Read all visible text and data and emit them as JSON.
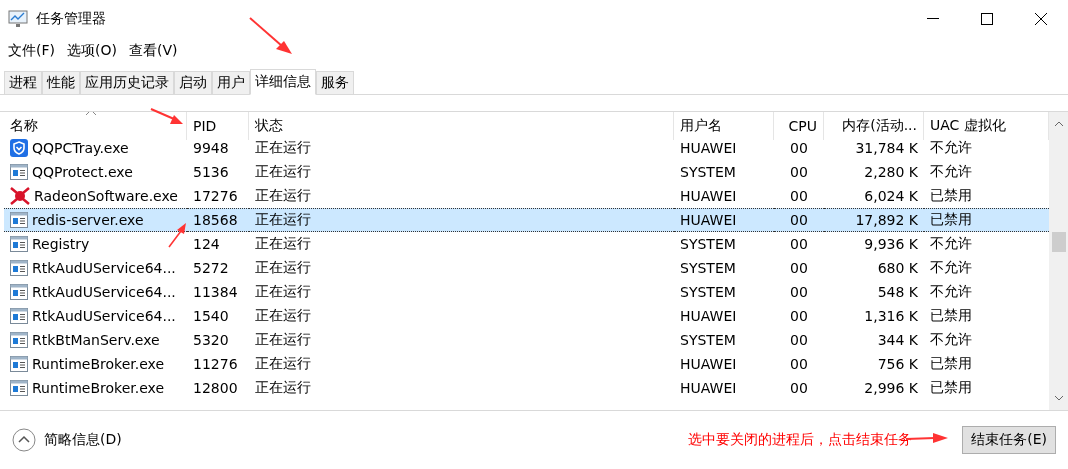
{
  "window": {
    "title": "任务管理器"
  },
  "menu": [
    "文件(F)",
    "选项(O)",
    "查看(V)"
  ],
  "tabs": [
    {
      "label": "进程",
      "selected": false
    },
    {
      "label": "性能",
      "selected": false
    },
    {
      "label": "应用历史记录",
      "selected": false
    },
    {
      "label": "启动",
      "selected": false
    },
    {
      "label": "用户",
      "selected": false
    },
    {
      "label": "详细信息",
      "selected": true
    },
    {
      "label": "服务",
      "selected": false
    }
  ],
  "table": {
    "columns": [
      "名称",
      "PID",
      "状态",
      "用户名",
      "CPU",
      "内存(活动...",
      "UAC 虚拟化"
    ],
    "rows": [
      {
        "kind": "shield",
        "selected": false,
        "cells": [
          "QQPCTray.exe",
          "9948",
          "正在运行",
          "HUAWEI",
          "00",
          "31,784 K",
          "不允许"
        ]
      },
      {
        "kind": "app",
        "selected": false,
        "cells": [
          "QQProtect.exe",
          "5136",
          "正在运行",
          "SYSTEM",
          "00",
          "2,280 K",
          "不允许"
        ]
      },
      {
        "kind": "radeon",
        "selected": false,
        "cells": [
          "RadeonSoftware.exe",
          "17276",
          "正在运行",
          "HUAWEI",
          "00",
          "6,024 K",
          "已禁用"
        ]
      },
      {
        "kind": "app",
        "selected": true,
        "cells": [
          "redis-server.exe",
          "18568",
          "正在运行",
          "HUAWEI",
          "00",
          "17,892 K",
          "已禁用"
        ]
      },
      {
        "kind": "app",
        "selected": false,
        "cells": [
          "Registry",
          "124",
          "正在运行",
          "SYSTEM",
          "00",
          "9,936 K",
          "不允许"
        ]
      },
      {
        "kind": "app",
        "selected": false,
        "cells": [
          "RtkAudUService64...",
          "5272",
          "正在运行",
          "SYSTEM",
          "00",
          "680 K",
          "不允许"
        ]
      },
      {
        "kind": "app",
        "selected": false,
        "cells": [
          "RtkAudUService64...",
          "11384",
          "正在运行",
          "SYSTEM",
          "00",
          "548 K",
          "不允许"
        ]
      },
      {
        "kind": "app",
        "selected": false,
        "cells": [
          "RtkAudUService64...",
          "1540",
          "正在运行",
          "HUAWEI",
          "00",
          "1,316 K",
          "已禁用"
        ]
      },
      {
        "kind": "app",
        "selected": false,
        "cells": [
          "RtkBtManServ.exe",
          "5320",
          "正在运行",
          "SYSTEM",
          "00",
          "344 K",
          "不允许"
        ]
      },
      {
        "kind": "app",
        "selected": false,
        "cells": [
          "RuntimeBroker.exe",
          "11276",
          "正在运行",
          "HUAWEI",
          "00",
          "756 K",
          "已禁用"
        ]
      },
      {
        "kind": "app",
        "selected": false,
        "cells": [
          "RuntimeBroker.exe",
          "12800",
          "正在运行",
          "HUAWEI",
          "00",
          "2,996 K",
          "已禁用"
        ]
      }
    ]
  },
  "footer": {
    "details_toggle": "简略信息(D)",
    "annotation": "选中要关闭的进程后，点击结束任务",
    "end_task_button": "结束任务(E)"
  }
}
